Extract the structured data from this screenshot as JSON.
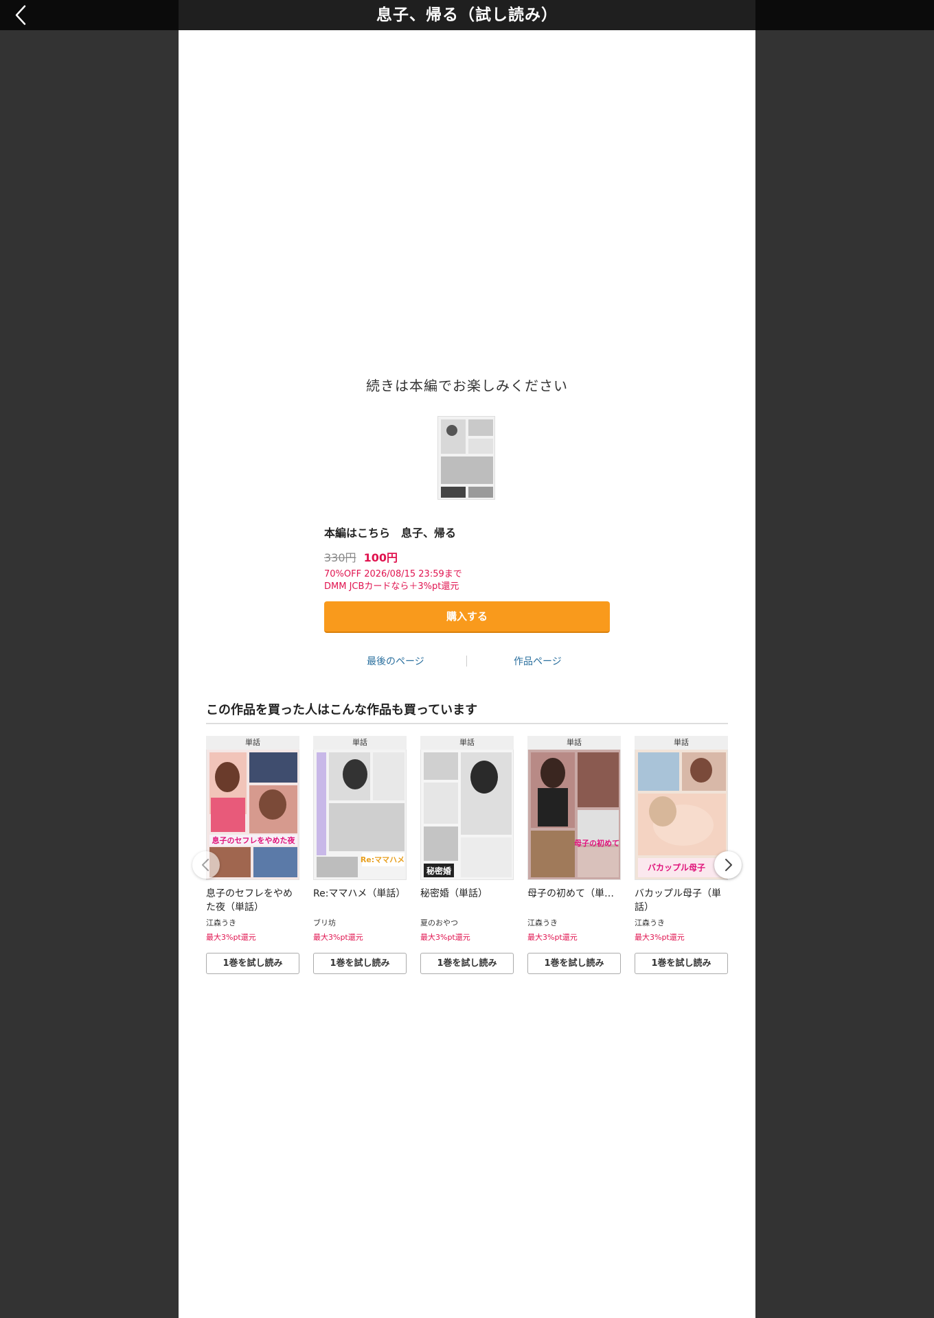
{
  "header": {
    "title": "息子、帰る（試し読み）",
    "back_icon": "chevron-left-icon"
  },
  "end_screen": {
    "continue_message": "続きは本編でお楽しみください",
    "main_title": "本編はこちら　息子、帰る",
    "price_original": "330円",
    "price_sale": "100円",
    "promo_line1": "70%OFF 2026/08/15 23:59まで",
    "promo_line2": "DMM JCBカードなら＋3%pt還元",
    "buy_label": "購入する",
    "last_page_link": "最後のページ",
    "work_page_link": "作品ページ"
  },
  "recommend": {
    "heading": "この作品を買った人はこんな作品も買っています",
    "items": [
      {
        "badge": "単話",
        "title": "息子のセフレをやめた夜（単話）",
        "author": "江森うき",
        "point": "最大3%pt還元",
        "button": "1巻を試し読み"
      },
      {
        "badge": "単話",
        "title": "Re:ママハメ（単話）",
        "author": "ブリ坊",
        "point": "最大3%pt還元",
        "button": "1巻を試し読み"
      },
      {
        "badge": "単話",
        "title": "秘密婚（単話）",
        "author": "夏のおやつ",
        "point": "最大3%pt還元",
        "button": "1巻を試し読み"
      },
      {
        "badge": "単話",
        "title": "母子の初めて（単…",
        "author": "江森うき",
        "point": "最大3%pt還元",
        "button": "1巻を試し読み"
      },
      {
        "badge": "単話",
        "title": "バカップル母子（単話）",
        "author": "江森うき",
        "point": "最大3%pt還元",
        "button": "1巻を試し読み"
      }
    ]
  },
  "colors": {
    "accent_orange": "#f99a1c",
    "sale_red": "#e0134f",
    "link_blue": "#2a6f9e"
  }
}
